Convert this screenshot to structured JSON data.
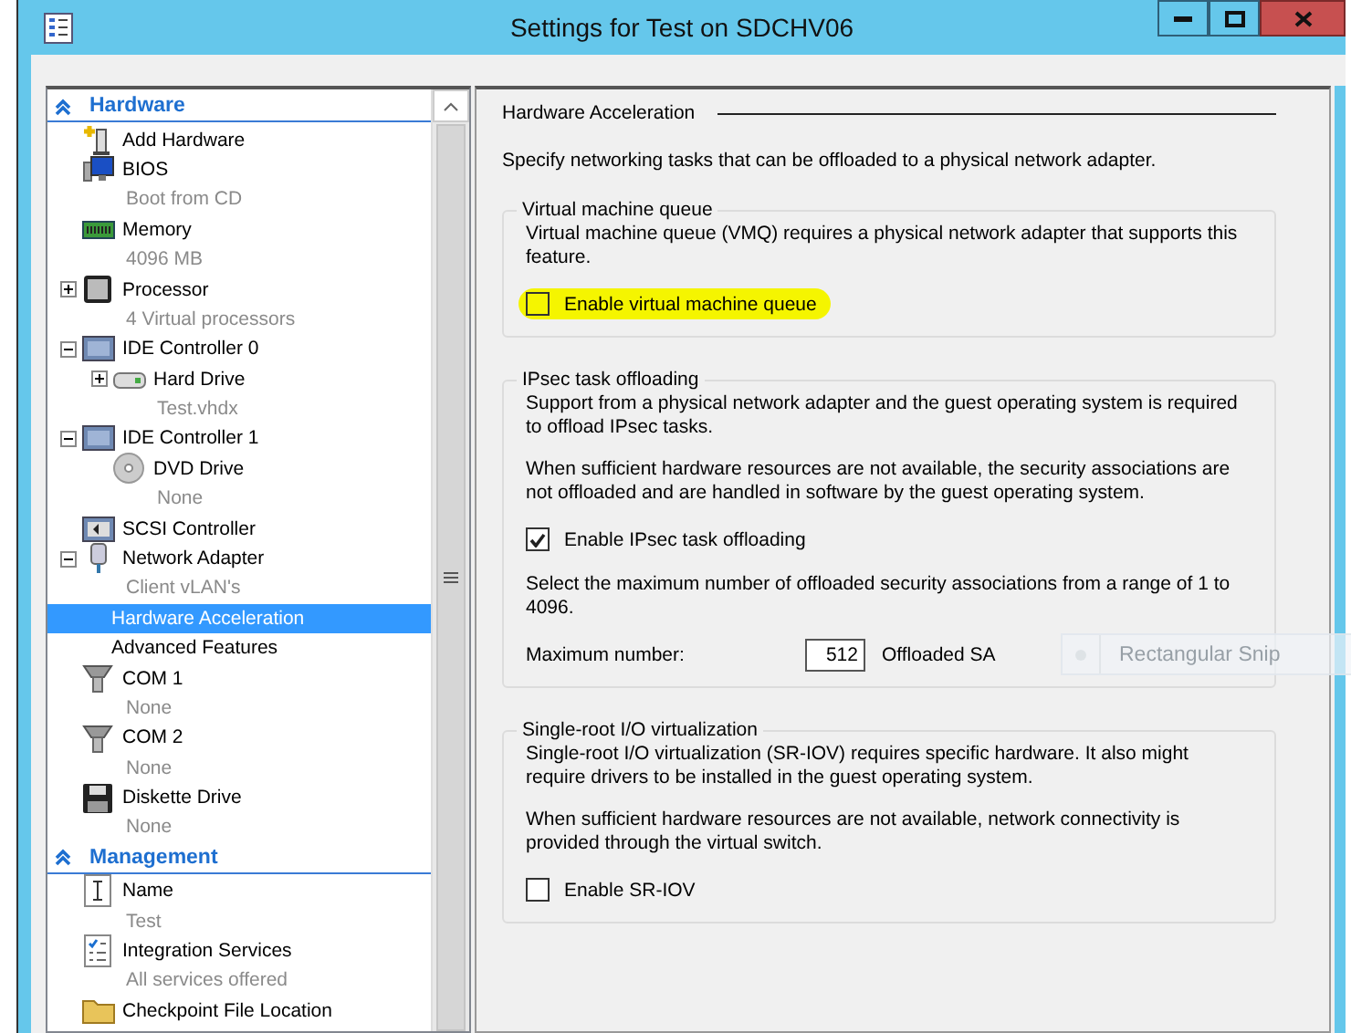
{
  "window": {
    "title": "Settings for Test on SDCHV06"
  },
  "sidebar": {
    "sections": [
      {
        "label": "Hardware",
        "expanded": true,
        "items": [
          {
            "label": "Add Hardware",
            "kind": "addhw",
            "selected": false
          },
          {
            "label": "BIOS",
            "detail": "Boot from CD",
            "kind": "bios",
            "selected": false
          },
          {
            "label": "Memory",
            "detail": "4096 MB",
            "kind": "memory",
            "selected": false
          },
          {
            "label": "Processor",
            "detail": "4 Virtual processors",
            "kind": "chip",
            "expanded": false,
            "selected": false
          },
          {
            "label": "IDE Controller 0",
            "kind": "controller",
            "expanded": true,
            "selected": false,
            "children": [
              {
                "label": "Hard Drive",
                "detail": "Test.vhdx",
                "kind": "disk",
                "expanded": false,
                "selected": false
              }
            ]
          },
          {
            "label": "IDE Controller 1",
            "kind": "controller",
            "expanded": true,
            "selected": false,
            "children": [
              {
                "label": "DVD Drive",
                "detail": "None",
                "kind": "dvd",
                "selected": false
              }
            ]
          },
          {
            "label": "SCSI Controller",
            "kind": "scsi",
            "selected": false
          },
          {
            "label": "Network Adapter",
            "detail": "Client vLAN's",
            "kind": "network",
            "expanded": true,
            "selected": false,
            "children": [
              {
                "label": "Hardware Acceleration",
                "kind": "plain",
                "selected": true
              },
              {
                "label": "Advanced Features",
                "kind": "plain",
                "selected": false
              }
            ]
          },
          {
            "label": "COM 1",
            "detail": "None",
            "kind": "port",
            "selected": false
          },
          {
            "label": "COM 2",
            "detail": "None",
            "kind": "port",
            "selected": false
          },
          {
            "label": "Diskette Drive",
            "detail": "None",
            "kind": "floppy",
            "selected": false
          }
        ]
      },
      {
        "label": "Management",
        "expanded": true,
        "items": [
          {
            "label": "Name",
            "detail": "Test",
            "kind": "name",
            "selected": false
          },
          {
            "label": "Integration Services",
            "detail": "All services offered",
            "kind": "services",
            "selected": false
          },
          {
            "label": "Checkpoint File Location",
            "kind": "folder",
            "selected": false
          }
        ]
      }
    ]
  },
  "pane": {
    "title": "Hardware Acceleration",
    "intro": "Specify networking tasks that can be offloaded to a physical network adapter.",
    "groups": [
      {
        "legend": "Virtual machine queue",
        "blocks": [
          {
            "kind": "text",
            "text": "Virtual machine queue (VMQ) requires a physical network adapter that supports this feature."
          },
          {
            "kind": "checkbox",
            "label": "Enable virtual machine queue",
            "checked": false,
            "highlighted": true
          }
        ]
      },
      {
        "legend": "IPsec task offloading",
        "blocks": [
          {
            "kind": "text",
            "text": "Support from a physical network adapter and the guest operating system is required to offload IPsec tasks."
          },
          {
            "kind": "text",
            "text": "When sufficient hardware resources are not available, the security associations are not offloaded and are handled in software by the guest operating system."
          },
          {
            "kind": "checkbox",
            "label": "Enable IPsec task offloading",
            "checked": true,
            "highlighted": false
          },
          {
            "kind": "text",
            "text": "Select the maximum number of offloaded security associations from a range of 1 to 4096."
          },
          {
            "kind": "field",
            "label": "Maximum number:",
            "value": "512",
            "unit": "Offloaded SA"
          }
        ]
      },
      {
        "legend": "Single-root I/O virtualization",
        "blocks": [
          {
            "kind": "text",
            "text": "Single-root I/O virtualization (SR-IOV) requires specific hardware. It also might require drivers to be installed in the guest operating system."
          },
          {
            "kind": "text",
            "text": "When sufficient hardware resources are not available, network connectivity is provided through the virtual switch."
          },
          {
            "kind": "checkbox",
            "label": "Enable SR-IOV",
            "checked": false,
            "highlighted": false
          }
        ]
      }
    ]
  },
  "overlay": {
    "label": "Rectangular Snip"
  }
}
